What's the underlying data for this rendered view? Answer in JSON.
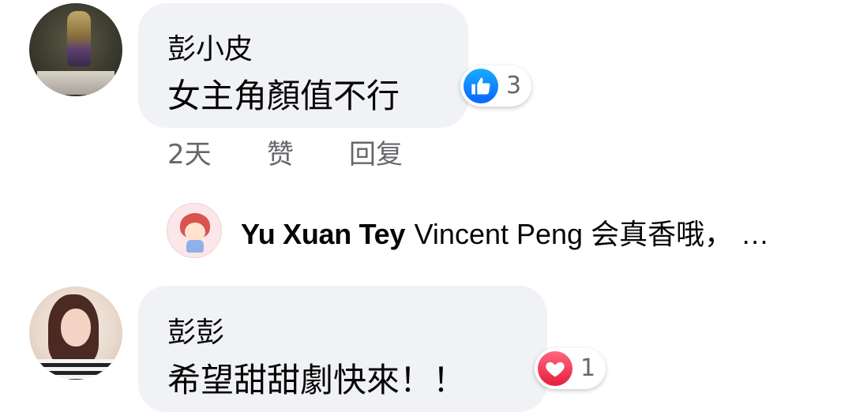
{
  "comments": [
    {
      "author": "彭小皮",
      "text": "女主角顏值不行",
      "reaction": {
        "icon": "like-icon",
        "count": "3",
        "color": "#1877f2"
      },
      "actions": {
        "time": "2天",
        "like": "赞",
        "reply": "回复"
      },
      "reply_preview": {
        "author": "Yu Xuan Tey",
        "text": "Vincent Peng 会真香哦， …"
      }
    },
    {
      "author": "彭彭",
      "text": "希望甜甜劇快來！！",
      "reaction": {
        "icon": "heart-icon",
        "count": "1",
        "color": "#f33e58"
      }
    }
  ]
}
